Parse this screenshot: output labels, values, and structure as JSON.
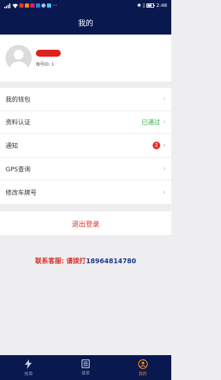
{
  "status_bar": {
    "left_icons": [
      "signal-icon",
      "wifi-icon",
      "app-icons"
    ],
    "ellipsis": "···",
    "time": "2:48"
  },
  "header": {
    "title": "我的"
  },
  "profile": {
    "account_id": "账号ID: 1"
  },
  "menu": {
    "items": [
      {
        "label": "我的钱包"
      },
      {
        "label": "资料认证",
        "status": "已通过"
      },
      {
        "label": "通知",
        "badge": "2"
      },
      {
        "label": "GPS查询"
      },
      {
        "label": "修改车牌号"
      }
    ]
  },
  "logout": {
    "label": "退出登录"
  },
  "contact": {
    "label": "联系客服: 请拨打",
    "phone": "18964814780"
  },
  "tabbar": {
    "tabs": [
      {
        "label": "抢单",
        "icon": "lightning-icon"
      },
      {
        "label": "接单",
        "icon": "list-icon"
      },
      {
        "label": "我的",
        "icon": "user-icon",
        "active": true
      }
    ]
  },
  "colors": {
    "nav": "#0a1850",
    "accent_red": "#d8332c",
    "verified_green": "#2ab03b",
    "phone_blue": "#1e3a8a",
    "active_tab": "#f28a1a"
  }
}
